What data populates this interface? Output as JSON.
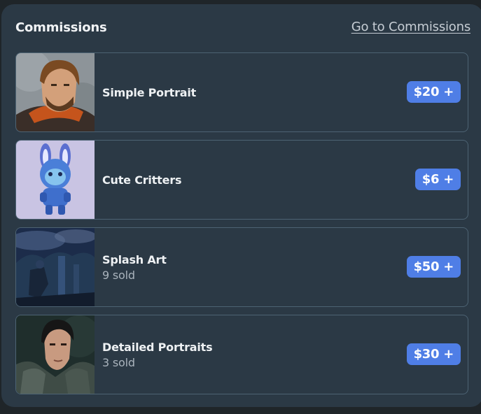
{
  "header": {
    "title": "Commissions",
    "link_label": "Go to Commissions"
  },
  "items": [
    {
      "name": "Simple Portrait",
      "sold": "",
      "price": "$20 +",
      "thumbnail_icon": "bearded-man-portrait"
    },
    {
      "name": "Cute Critters",
      "sold": "",
      "price": "$6 +",
      "thumbnail_icon": "blue-bunny-critter"
    },
    {
      "name": "Splash Art",
      "sold": "9 sold",
      "price": "$50 +",
      "thumbnail_icon": "night-scene-splash"
    },
    {
      "name": "Detailed Portraits",
      "sold": "3 sold",
      "price": "$30 +",
      "thumbnail_icon": "armored-man-portrait"
    }
  ],
  "colors": {
    "panel": "#2b3945",
    "price_badge": "#4f7ee6",
    "card_border": "#4d6373"
  }
}
